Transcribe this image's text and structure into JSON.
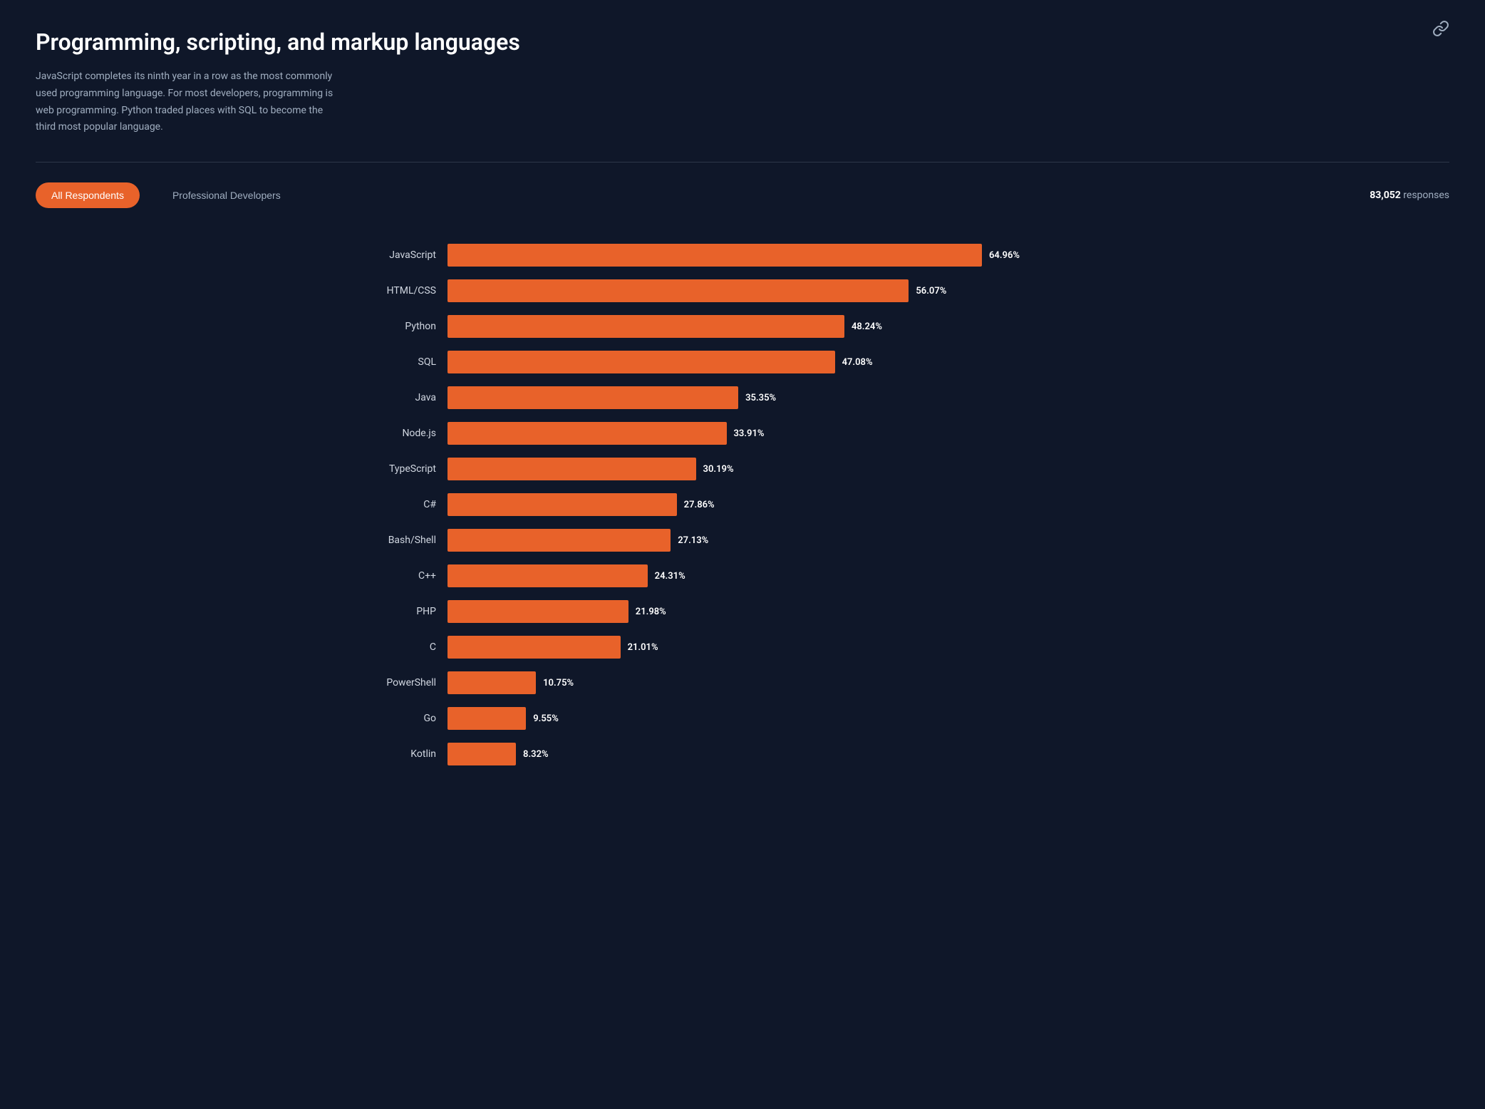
{
  "page": {
    "title": "Programming, scripting, and markup languages",
    "description": "JavaScript completes its ninth year in a row as the most commonly used programming language. For most developers, programming is web programming. Python traded places with SQL to become the third most popular language.",
    "link_icon": "link"
  },
  "filter": {
    "tabs": [
      {
        "id": "all",
        "label": "All Respondents",
        "active": true
      },
      {
        "id": "pro",
        "label": "Professional Developers",
        "active": false
      }
    ],
    "responses_label": "responses",
    "responses_count": "83,052"
  },
  "chart": {
    "max_pct": 64.96,
    "bars": [
      {
        "label": "JavaScript",
        "pct": 64.96,
        "pct_display": "64.96%"
      },
      {
        "label": "HTML/CSS",
        "pct": 56.07,
        "pct_display": "56.07%"
      },
      {
        "label": "Python",
        "pct": 48.24,
        "pct_display": "48.24%"
      },
      {
        "label": "SQL",
        "pct": 47.08,
        "pct_display": "47.08%"
      },
      {
        "label": "Java",
        "pct": 35.35,
        "pct_display": "35.35%"
      },
      {
        "label": "Node.js",
        "pct": 33.91,
        "pct_display": "33.91%"
      },
      {
        "label": "TypeScript",
        "pct": 30.19,
        "pct_display": "30.19%"
      },
      {
        "label": "C#",
        "pct": 27.86,
        "pct_display": "27.86%"
      },
      {
        "label": "Bash/Shell",
        "pct": 27.13,
        "pct_display": "27.13%"
      },
      {
        "label": "C++",
        "pct": 24.31,
        "pct_display": "24.31%"
      },
      {
        "label": "PHP",
        "pct": 21.98,
        "pct_display": "21.98%"
      },
      {
        "label": "C",
        "pct": 21.01,
        "pct_display": "21.01%"
      },
      {
        "label": "PowerShell",
        "pct": 10.75,
        "pct_display": "10.75%"
      },
      {
        "label": "Go",
        "pct": 9.55,
        "pct_display": "9.55%"
      },
      {
        "label": "Kotlin",
        "pct": 8.32,
        "pct_display": "8.32%"
      }
    ]
  }
}
